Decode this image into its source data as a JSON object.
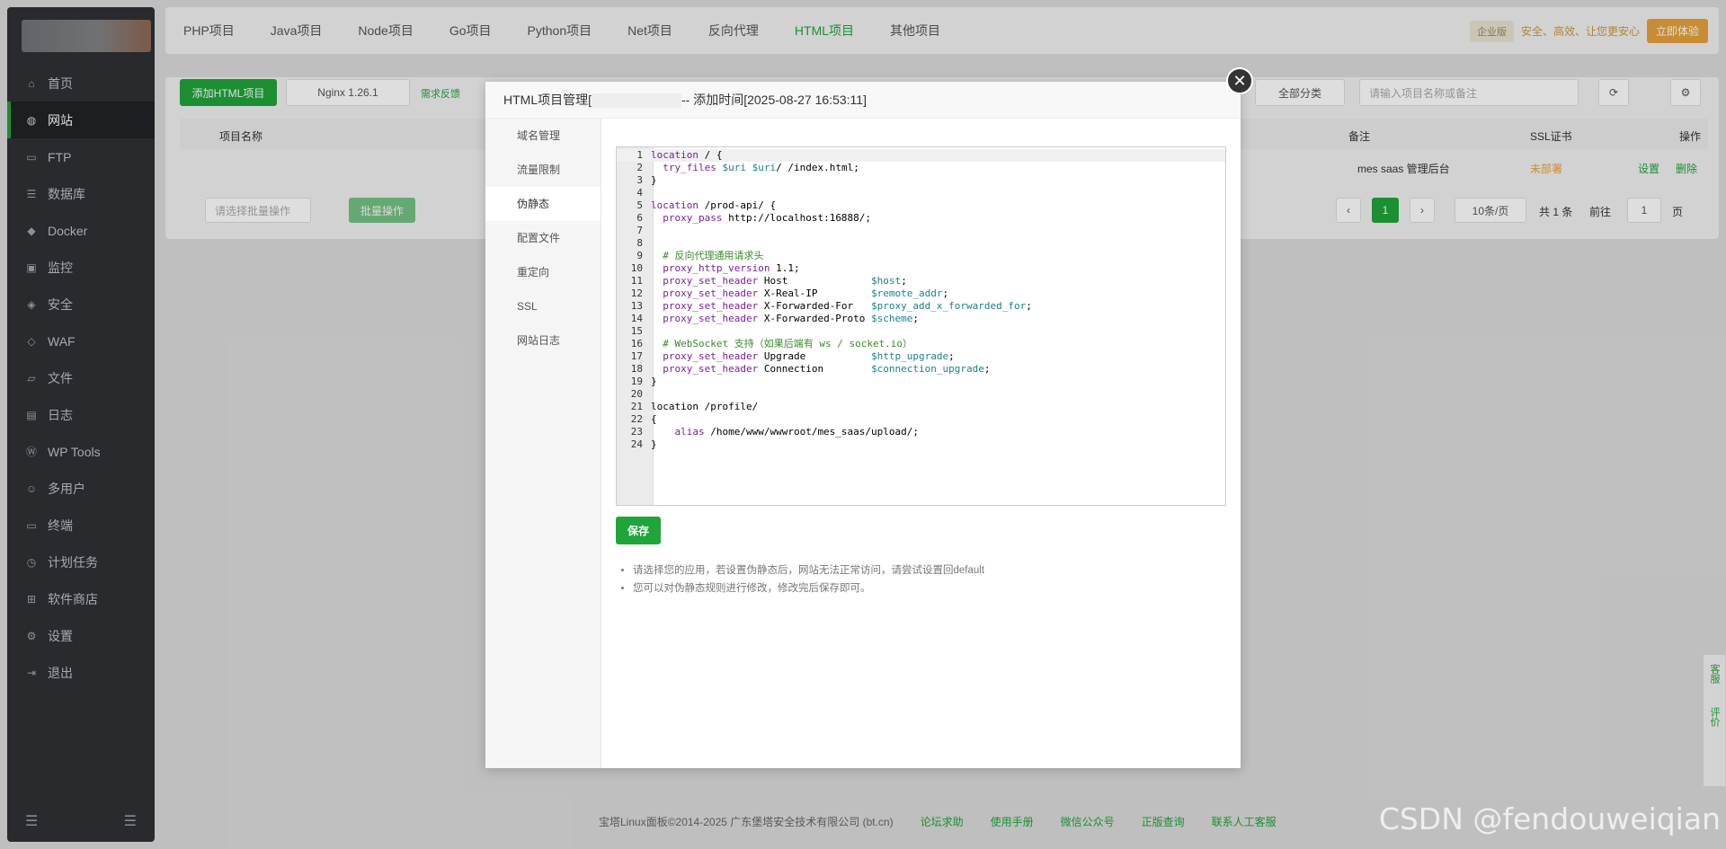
{
  "sidebar": {
    "items": [
      {
        "label": "首页",
        "icon": "home-icon"
      },
      {
        "label": "网站",
        "icon": "globe-icon",
        "active": true
      },
      {
        "label": "FTP",
        "icon": "ftp-icon"
      },
      {
        "label": "数据库",
        "icon": "database-icon"
      },
      {
        "label": "Docker",
        "icon": "docker-icon"
      },
      {
        "label": "监控",
        "icon": "monitor-icon"
      },
      {
        "label": "安全",
        "icon": "shield-icon"
      },
      {
        "label": "WAF",
        "icon": "waf-icon"
      },
      {
        "label": "文件",
        "icon": "folder-icon"
      },
      {
        "label": "日志",
        "icon": "log-icon"
      },
      {
        "label": "WP Tools",
        "icon": "wordpress-icon"
      },
      {
        "label": "多用户",
        "icon": "users-icon"
      },
      {
        "label": "终端",
        "icon": "terminal-icon"
      },
      {
        "label": "计划任务",
        "icon": "clock-icon"
      },
      {
        "label": "软件商店",
        "icon": "apps-icon"
      },
      {
        "label": "设置",
        "icon": "gear-icon"
      },
      {
        "label": "退出",
        "icon": "logout-icon"
      }
    ]
  },
  "topnav": {
    "tabs": [
      "PHP项目",
      "Java项目",
      "Node项目",
      "Go项目",
      "Python项目",
      "Net项目",
      "反向代理",
      "HTML项目",
      "其他项目"
    ],
    "active": "HTML项目",
    "enterprise_badge": "企业版",
    "slogan": "安全、高效、让您更安心",
    "trial_button": "立即体验"
  },
  "main": {
    "add_button": "添加HTML项目",
    "nginx_button": "Nginx 1.26.1",
    "feedback": "需求反馈",
    "category_select": "全部分类",
    "search_placeholder": "请输入项目名称或备注",
    "col_name": "项目名称",
    "col_remark": "备注",
    "col_ssl": "SSL证书",
    "col_ops": "操作",
    "row_remark": "mes saas 管理后台",
    "row_ssl": "未部署",
    "row_setting": "设置",
    "row_delete": "删除",
    "batch_select": "请选择批量操作",
    "batch_button": "批量操作",
    "page_current": "1",
    "page_size": "10条/页",
    "total": "共 1 条",
    "goto": "前往",
    "goto_value": "1",
    "page_unit": "页"
  },
  "dialog": {
    "title_prefix": "HTML项目管理[",
    "title_suffix": "-- 添加时间[2025-08-27 16:53:11]",
    "side_items": [
      "域名管理",
      "流量限制",
      "伪静态",
      "配置文件",
      "重定向",
      "SSL",
      "网站日志"
    ],
    "active_side": "伪静态",
    "save_button": "保存",
    "tips": [
      "请选择您的应用，若设置伪静态后，网站无法正常访问，请尝试设置回default",
      "您可以对伪静态规则进行修改，修改完后保存即可。"
    ]
  },
  "code": {
    "line_numbers": [
      "1",
      "2",
      "3",
      "4",
      "5",
      "6",
      "7",
      "8",
      "9",
      "10",
      "11",
      "12",
      "13",
      "14",
      "15",
      "16",
      "17",
      "18",
      "19",
      "20",
      "21",
      "22",
      "23",
      "24"
    ],
    "l1a": "location",
    "l1b": " / {",
    "l2a": "  try_files ",
    "l2b": "$uri",
    "l2c": " ",
    "l2d": "$uri",
    "l2e": "/ /index.html;",
    "l3": "}",
    "l5a": "location",
    "l5b": " /prod-api/ {",
    "l6a": "  proxy_pass",
    "l6b": " http://localhost:16888/;",
    "l9": "  # 反向代理通用请求头",
    "l10a": "  proxy_http_version",
    "l10b": " 1.1;",
    "l11a": "  proxy_set_header",
    "l11b": " Host              ",
    "l11c": "$host",
    "l11d": ";",
    "l12a": "  proxy_set_header",
    "l12b": " X-Real-IP         ",
    "l12c": "$remote_addr",
    "l12d": ";",
    "l13a": "  proxy_set_header",
    "l13b": " X-Forwarded-For   ",
    "l13c": "$proxy_add_x_forwarded_for",
    "l13d": ";",
    "l14a": "  proxy_set_header",
    "l14b": " X-Forwarded-Proto ",
    "l14c": "$scheme",
    "l14d": ";",
    "l16": "  # WebSocket 支持（如果后端有 ws / socket.io）",
    "l17a": "  proxy_set_header",
    "l17b": " Upgrade           ",
    "l17c": "$http_upgrade",
    "l17d": ";",
    "l18a": "  proxy_set_header",
    "l18b": " Connection        ",
    "l18c": "$connection_upgrade",
    "l18d": ";",
    "l19": "}",
    "l21": "location /profile/",
    "l22": "{",
    "l23a": "    alias",
    "l23b": " /home/www/wwwroot/mes_saas/upload/;",
    "l24": "}"
  },
  "footer": {
    "copyright": "宝塔Linux面板©2014-2025 广东堡塔安全技术有限公司 (bt.cn)",
    "links": [
      "论坛求助",
      "使用手册",
      "微信公众号",
      "正版查询",
      "联系人工客服"
    ]
  },
  "float": {
    "service": "客服",
    "review": "评价"
  },
  "watermark": "CSDN @fendouweiqian"
}
